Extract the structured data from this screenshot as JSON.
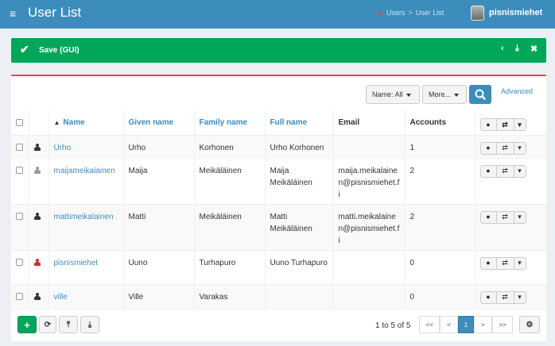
{
  "header": {
    "title": "User List",
    "breadcrumb": [
      "Users",
      "User List"
    ],
    "username": "pisnismiehet"
  },
  "savebar": {
    "label": "Save (GUI)"
  },
  "filters": {
    "name_filter": "Name: All",
    "more": "More...",
    "advanced": "Advanced"
  },
  "table": {
    "columns": [
      "Name",
      "Given name",
      "Family name",
      "Full name",
      "Email",
      "Accounts"
    ],
    "rows": [
      {
        "name": "Urho",
        "given": "Urho",
        "family": "Korhonen",
        "full": "Urho Korhonen",
        "email": "",
        "accounts": "1",
        "icon_color": "#333333"
      },
      {
        "name": "maijameikalainen",
        "given": "Maija",
        "family": "Meikäläinen",
        "full": "Maija Meikäläinen",
        "email": "maija.meikalainen@pisnismiehet.fi",
        "accounts": "2",
        "icon_color": "#999999"
      },
      {
        "name": "mattimeikalainen",
        "given": "Matti",
        "family": "Meikäläinen",
        "full": "Matti Meikäläinen",
        "email": "matti.meikalainen@pisnismiehet.fi",
        "accounts": "2",
        "icon_color": "#333333"
      },
      {
        "name": "pisnismiehet",
        "given": "Uuno",
        "family": "Turhapuro",
        "full": "Uuno Turhapuro",
        "email": "",
        "accounts": "0",
        "icon_color": "#c9302c"
      },
      {
        "name": "ville",
        "given": "Ville",
        "family": "Varakas",
        "full": "",
        "email": "",
        "accounts": "0",
        "icon_color": "#333333"
      }
    ]
  },
  "pagination": {
    "info": "1 to 5 of 5",
    "first": "<<",
    "prev": "<",
    "current": "1",
    "next": ">",
    "last": ">>"
  },
  "icons": {
    "menu": "hamburger-icon",
    "save": "check-icon",
    "collapse": "chevron-left-icon",
    "download": "download-icon",
    "close": "close-icon",
    "search": "search-icon",
    "user": "user-icon",
    "transfer": "transfer-icon",
    "add": "plus-icon",
    "refresh": "refresh-icon",
    "upload": "upload-icon",
    "settings": "gear-icon"
  },
  "colors": {
    "header": "#3c8dbc",
    "success": "#00a65a",
    "danger": "#dd4b39",
    "link": "#3c8dbc"
  }
}
